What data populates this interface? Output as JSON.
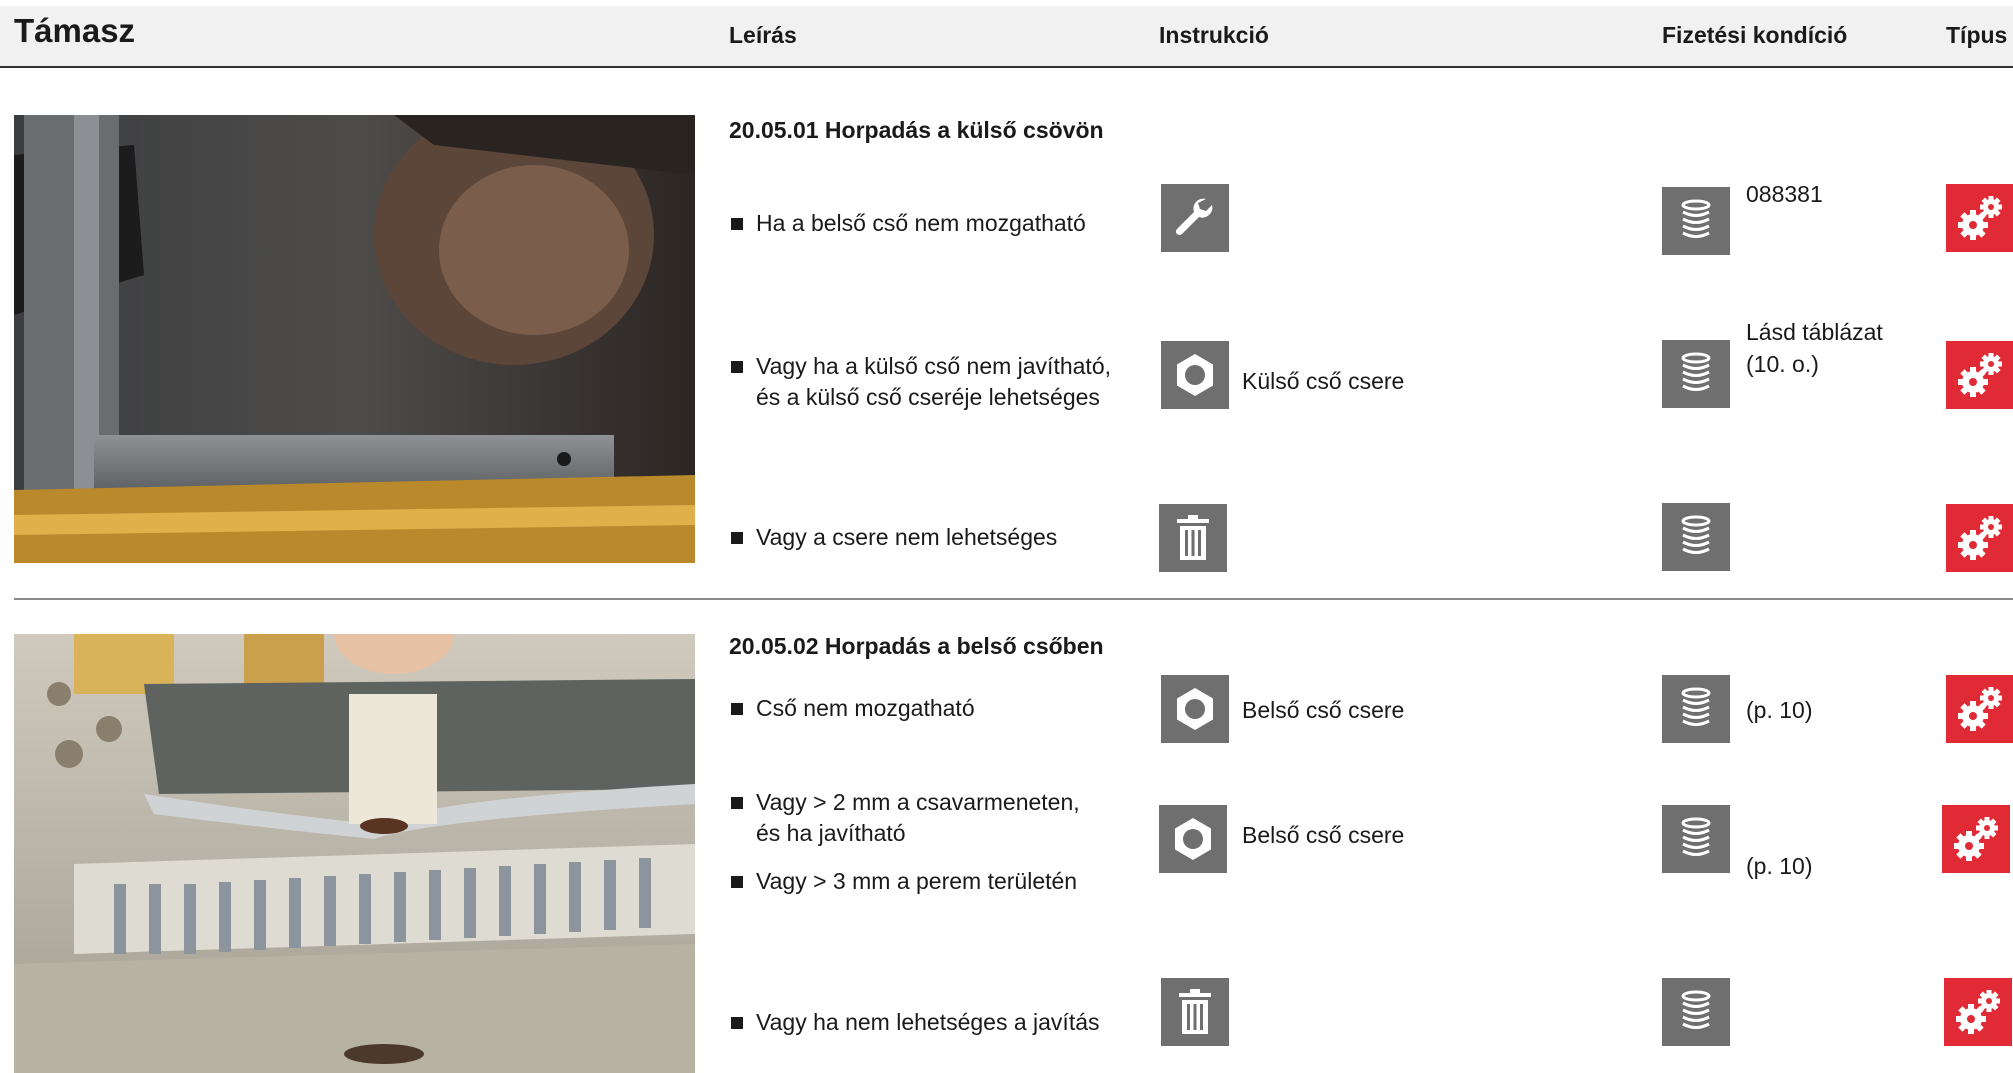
{
  "header": {
    "title": "Támasz",
    "col_description": "Leírás",
    "col_instruction": "Instrukció",
    "col_payment": "Fizetési kondíció",
    "col_type": "Típus"
  },
  "sections": [
    {
      "title": "20.05.01 Horpadás a külső csövön",
      "items": [
        {
          "lines": [
            "Ha a belső cső nem mozgatható"
          ],
          "instruction_icon": "wrench-icon",
          "instruction_label": "",
          "payment_icon": "coin-stack-icon",
          "payment_lines": [
            "088381"
          ],
          "type_icon": "gears-icon"
        },
        {
          "lines": [
            "Vagy ha a külső cső nem javítható,",
            "és a külső cső cseréje lehetséges"
          ],
          "instruction_icon": "nut-icon",
          "instruction_label": "Külső cső csere",
          "payment_icon": "coin-stack-icon",
          "payment_lines": [
            "Lásd táblázat",
            "(10. o.)"
          ],
          "type_icon": "gears-icon"
        },
        {
          "lines": [
            "Vagy a csere nem lehetséges"
          ],
          "instruction_icon": "trash-icon",
          "instruction_label": "",
          "payment_icon": "coin-stack-icon",
          "payment_lines": [],
          "type_icon": "gears-icon"
        }
      ]
    },
    {
      "title": "20.05.02 Horpadás a belső csőben",
      "items": [
        {
          "lines": [
            "Cső nem mozgatható"
          ],
          "instruction_icon": "nut-icon",
          "instruction_label": "Belső cső csere",
          "payment_icon": "coin-stack-icon",
          "payment_lines": [
            "(p. 10)"
          ],
          "type_icon": "gears-icon"
        },
        {
          "lines": [
            "Vagy > 2 mm a csavarmeneten,",
            "és ha javítható"
          ],
          "instruction_icon": "nut-icon",
          "instruction_label": "Belső cső csere",
          "payment_icon": "coin-stack-icon",
          "payment_lines": [
            "(p. 10)"
          ],
          "type_icon": "gears-icon"
        },
        {
          "lines": [
            "Vagy > 3 mm a perem területén"
          ]
        },
        {
          "lines": [
            "Vagy ha nem lehetséges a javítás"
          ],
          "instruction_icon": "trash-icon",
          "instruction_label": "",
          "payment_icon": "coin-stack-icon",
          "payment_lines": [],
          "type_icon": "gears-icon"
        }
      ]
    }
  ],
  "colors": {
    "tile_gray": "#6f6f6f",
    "type_red": "#e02a35",
    "header_band": "#f1f1f1"
  }
}
